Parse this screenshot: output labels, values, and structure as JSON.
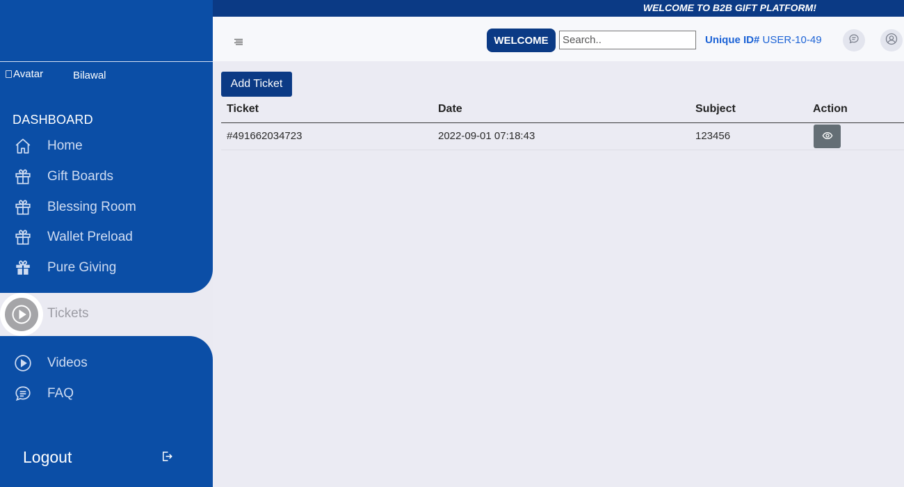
{
  "banner": {
    "text": "WELCOME TO B2B GIFT PLATFORM!"
  },
  "header": {
    "welcome_label": "WELCOME",
    "search_placeholder": "Search..",
    "uid_label": "Unique ID#",
    "uid_value": "USER-10-49"
  },
  "sidebar": {
    "avatar_alt": "Avatar",
    "username": "Bilawal",
    "section": "DASHBOARD",
    "items": [
      {
        "label": "Home",
        "icon": "home-icon"
      },
      {
        "label": "Gift Boards",
        "icon": "gift-icon"
      },
      {
        "label": "Blessing Room",
        "icon": "gift-icon"
      },
      {
        "label": "Wallet Preload",
        "icon": "gift-icon"
      },
      {
        "label": "Pure Giving",
        "icon": "gift-filled-icon"
      },
      {
        "label": "Tickets",
        "icon": "play-circle-icon",
        "active": true
      },
      {
        "label": "Videos",
        "icon": "play-circle-icon"
      },
      {
        "label": "FAQ",
        "icon": "chat-icon"
      }
    ],
    "logout_label": "Logout"
  },
  "main": {
    "add_ticket_label": "Add Ticket",
    "columns": [
      "Ticket",
      "Date",
      "Subject",
      "Action"
    ],
    "rows": [
      {
        "ticket": "#491662034723",
        "date": "2022-09-01 07:18:43",
        "subject": "123456",
        "action_icon": "eye-icon"
      }
    ]
  },
  "colors": {
    "sidebar": "#0b4ea6",
    "banner": "#0b3a85",
    "accent_link": "#1c63d6",
    "view_button": "#646e75"
  }
}
